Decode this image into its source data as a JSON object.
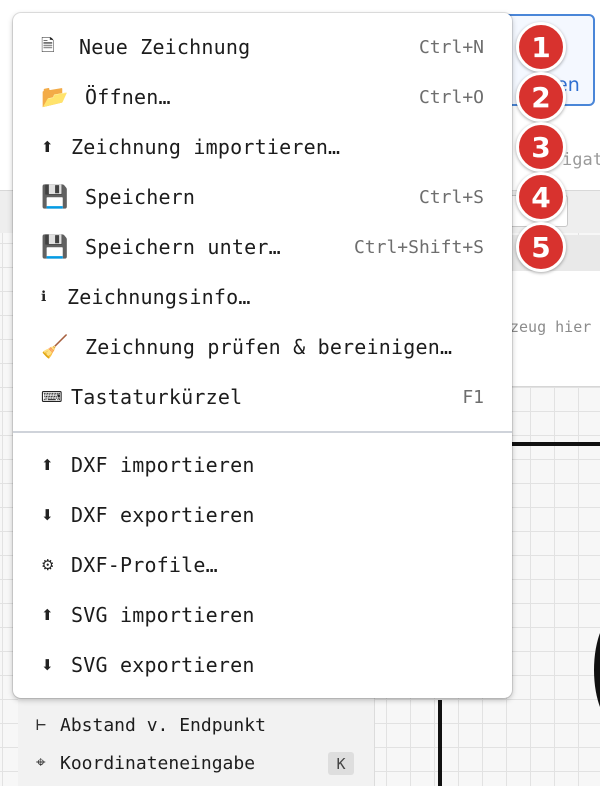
{
  "background": {
    "toolbar_button_label": "en",
    "tab_label": "igat",
    "hint_text": "zeug hier",
    "snap_panel": {
      "items": [
        {
          "icon": "⊢",
          "label": "Abstand v. Endpunkt"
        },
        {
          "icon": "⌖",
          "label": "Koordinateneingabe",
          "key": "K"
        }
      ]
    }
  },
  "menu": {
    "items": [
      {
        "icon": "🗎",
        "label": "Neue Zeichnung",
        "shortcut": "Ctrl+N"
      },
      {
        "icon": "📂",
        "label": "Öffnen…",
        "shortcut": "Ctrl+O"
      },
      {
        "icon": "⬆",
        "label": "Zeichnung importieren…",
        "shortcut": ""
      },
      {
        "icon": "💾",
        "label": "Speichern",
        "shortcut": "Ctrl+S"
      },
      {
        "icon": "💾",
        "label": "Speichern unter…",
        "shortcut": "Ctrl+Shift+S"
      },
      {
        "icon": "ℹ",
        "label": "Zeichnungsinfo…",
        "shortcut": ""
      },
      {
        "icon": "🧹",
        "label": "Zeichnung prüfen & bereinigen…",
        "shortcut": ""
      },
      {
        "icon": "⌨",
        "label": "Tastaturkürzel",
        "shortcut": "F1"
      },
      {
        "icon": "⬆",
        "label": "DXF importieren",
        "shortcut": ""
      },
      {
        "icon": "⬇",
        "label": "DXF exportieren",
        "shortcut": ""
      },
      {
        "icon": "⚙",
        "label": "DXF-Profile…",
        "shortcut": ""
      },
      {
        "icon": "⬆",
        "label": "SVG importieren",
        "shortcut": ""
      },
      {
        "icon": "⬇",
        "label": "SVG exportieren",
        "shortcut": ""
      }
    ]
  },
  "badges": [
    "1",
    "2",
    "3",
    "4",
    "5"
  ],
  "colors": {
    "badge": "#d8322e",
    "accent_blue": "#2f6fd1",
    "separator": "#cfd3da"
  }
}
